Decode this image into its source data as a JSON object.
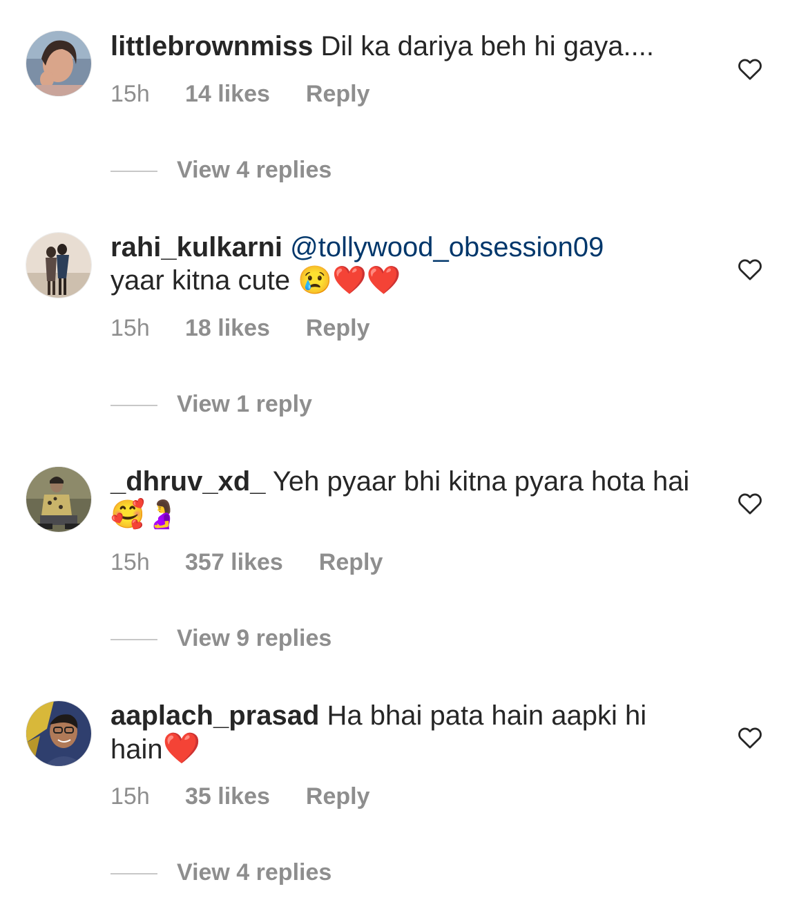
{
  "colors": {
    "text": "#262626",
    "secondary": "#8e8e8e",
    "mention": "#00376b",
    "heart_emoji": "#e0112b"
  },
  "comments": [
    {
      "username": "littlebrownmiss",
      "text": "Dil ka dariya beh hi gaya....",
      "time": "15h",
      "likes": "14 likes",
      "reply_label": "Reply",
      "view_replies": "View 4 replies",
      "avatar_icon": "woman-portrait-avatar",
      "like_icon": "heart-outline-icon"
    },
    {
      "username": "rahi_kulkarni",
      "mention": "@tollywood_obsession09",
      "text": "yaar kitna cute",
      "emojis": "😢❤️❤️",
      "time": "15h",
      "likes": "18 likes",
      "reply_label": "Reply",
      "view_replies": "View 1 reply",
      "avatar_icon": "couple-beach-avatar",
      "like_icon": "heart-outline-icon"
    },
    {
      "username": "_dhruv_xd_",
      "text": "Yeh pyaar bhi kitna pyara hota hai",
      "emojis": "🥰🤰",
      "time": "15h",
      "likes": "357 likes",
      "reply_label": "Reply",
      "view_replies": "View 9 replies",
      "avatar_icon": "man-sitting-avatar",
      "like_icon": "heart-outline-icon"
    },
    {
      "username": "aaplach_prasad",
      "text": "Ha bhai pata hain aapki hi hain",
      "emojis": "❤️",
      "time": "15h",
      "likes": "35 likes",
      "reply_label": "Reply",
      "view_replies": "View 4 replies",
      "avatar_icon": "man-glasses-avatar",
      "like_icon": "heart-outline-icon"
    }
  ]
}
